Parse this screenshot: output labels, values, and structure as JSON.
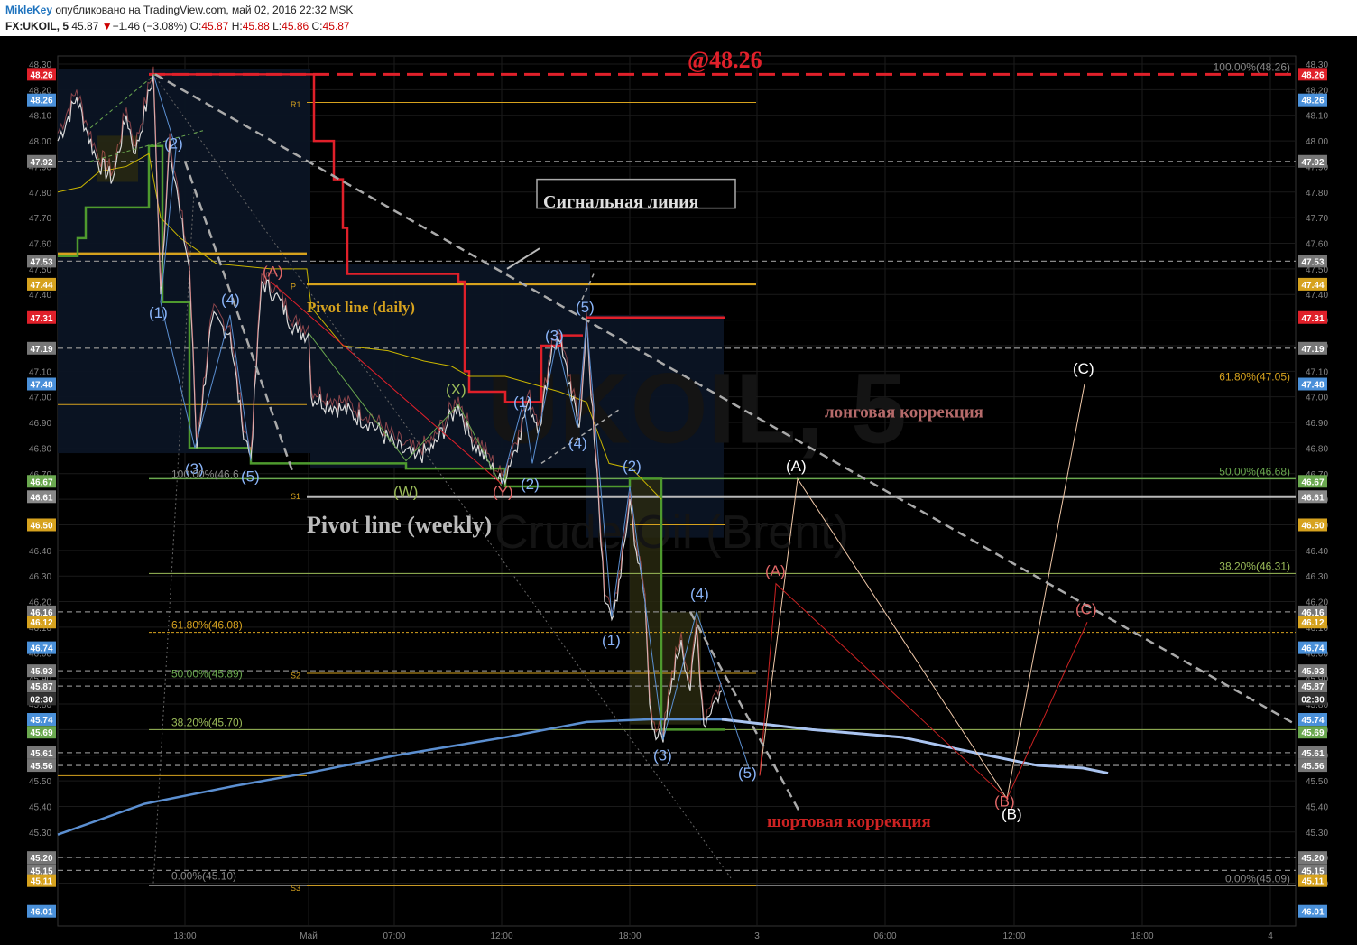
{
  "header": {
    "author": "MikleKey",
    "published": "опубликовано на TradingView.com, май 02, 2016 22:32 MSK",
    "symbol": "FX:UKOIL, 5",
    "last": "45.87",
    "down_arrow": "▼",
    "change": "−1.46 (−3.08%)",
    "o_label": "O:",
    "o_value": "45.87",
    "h_label": "H:",
    "h_value": "45.88",
    "l_label": "L:",
    "l_value": "45.86",
    "c_label": "C:",
    "c_value": "45.87"
  },
  "chart_data": {
    "type": "line",
    "ylim": [
      45.0,
      48.33
    ],
    "y_ticks": [
      "48.30",
      "48.20",
      "48.10",
      "48.00",
      "47.90",
      "47.80",
      "47.70",
      "47.60",
      "47.50",
      "47.40",
      "47.30",
      "47.20",
      "47.10",
      "47.00",
      "46.90",
      "46.80",
      "46.70",
      "46.60",
      "46.50",
      "46.40",
      "46.30",
      "46.20",
      "46.10",
      "46.00",
      "45.90",
      "45.80",
      "45.70",
      "45.60",
      "45.50",
      "45.40",
      "45.30",
      "45.20",
      "45.10"
    ],
    "x_ticks": [
      "18:00",
      "Май",
      "07:00",
      "12:00",
      "18:00",
      "3",
      "06:00",
      "12:00",
      "18:00",
      "4"
    ],
    "watermark": [
      "UKOIL, 5",
      "Crude Oil (Brent)"
    ],
    "left_price_labels": [
      {
        "text": "48.26",
        "color": "#e0202a",
        "y": 48.26
      },
      {
        "text": "48.26",
        "color": "#4a90d9",
        "y": 48.16
      },
      {
        "text": "47.92",
        "color": "#777777",
        "y": 47.92
      },
      {
        "text": "47.53",
        "color": "#777777",
        "y": 47.53
      },
      {
        "text": "47.44",
        "color": "#d6a21e",
        "y": 47.44
      },
      {
        "text": "47.31",
        "color": "#e0202a",
        "y": 47.31
      },
      {
        "text": "47.19",
        "color": "#777777",
        "y": 47.19
      },
      {
        "text": "47.48",
        "color": "#4a90d9",
        "y": 47.05
      },
      {
        "text": "46.67",
        "color": "#6aa84f",
        "y": 46.67
      },
      {
        "text": "46.61",
        "color": "#888888",
        "y": 46.61
      },
      {
        "text": "46.50",
        "color": "#d6a21e",
        "y": 46.5
      },
      {
        "text": "46.16",
        "color": "#777777",
        "y": 46.16
      },
      {
        "text": "46.12",
        "color": "#d6a21e",
        "y": 46.12
      },
      {
        "text": "46.74",
        "color": "#4a90d9",
        "y": 46.02
      },
      {
        "text": "45.93",
        "color": "#777777",
        "y": 45.93
      },
      {
        "text": "45.87",
        "color": "#777777",
        "y": 45.87
      },
      {
        "text": "02:30",
        "color": "#333333",
        "y": 45.82
      },
      {
        "text": "45.74",
        "color": "#4a90d9",
        "y": 45.74
      },
      {
        "text": "45.69",
        "color": "#6aa84f",
        "y": 45.69
      },
      {
        "text": "45.61",
        "color": "#777777",
        "y": 45.61
      },
      {
        "text": "45.56",
        "color": "#777777",
        "y": 45.56
      },
      {
        "text": "45.20",
        "color": "#777777",
        "y": 45.2
      },
      {
        "text": "45.15",
        "color": "#777777",
        "y": 45.15
      },
      {
        "text": "45.11",
        "color": "#d6a21e",
        "y": 45.11
      },
      {
        "text": "46.01",
        "color": "#4a90d9",
        "y": 44.99
      }
    ],
    "right_price_labels": [
      {
        "text": "48.26",
        "color": "#e0202a",
        "y": 48.26
      },
      {
        "text": "48.26",
        "color": "#4a90d9",
        "y": 48.16
      },
      {
        "text": "47.92",
        "color": "#777777",
        "y": 47.92
      },
      {
        "text": "47.53",
        "color": "#777777",
        "y": 47.53
      },
      {
        "text": "47.44",
        "color": "#d6a21e",
        "y": 47.44
      },
      {
        "text": "47.31",
        "color": "#e0202a",
        "y": 47.31
      },
      {
        "text": "47.19",
        "color": "#777777",
        "y": 47.19
      },
      {
        "text": "47.48",
        "color": "#4a90d9",
        "y": 47.05
      },
      {
        "text": "46.67",
        "color": "#6aa84f",
        "y": 46.67
      },
      {
        "text": "46.61",
        "color": "#888888",
        "y": 46.61
      },
      {
        "text": "46.50",
        "color": "#d6a21e",
        "y": 46.5
      },
      {
        "text": "46.16",
        "color": "#777777",
        "y": 46.16
      },
      {
        "text": "46.12",
        "color": "#d6a21e",
        "y": 46.12
      },
      {
        "text": "46.74",
        "color": "#4a90d9",
        "y": 46.02
      },
      {
        "text": "45.93",
        "color": "#777777",
        "y": 45.93
      },
      {
        "text": "45.87",
        "color": "#777777",
        "y": 45.87
      },
      {
        "text": "02:30",
        "color": "#333333",
        "y": 45.82
      },
      {
        "text": "45.74",
        "color": "#4a90d9",
        "y": 45.74
      },
      {
        "text": "45.69",
        "color": "#6aa84f",
        "y": 45.69
      },
      {
        "text": "45.61",
        "color": "#777777",
        "y": 45.61
      },
      {
        "text": "45.56",
        "color": "#777777",
        "y": 45.56
      },
      {
        "text": "45.20",
        "color": "#777777",
        "y": 45.2
      },
      {
        "text": "45.15",
        "color": "#777777",
        "y": 45.15
      },
      {
        "text": "45.11",
        "color": "#d6a21e",
        "y": 45.11
      },
      {
        "text": "46.01",
        "color": "#4a90d9",
        "y": 44.99
      }
    ],
    "fib_labels": [
      {
        "text": "100.00%(48.26)",
        "color": "#888888",
        "y": 48.26,
        "side": "right"
      },
      {
        "text": "61.80%(47.05)",
        "color": "#d6a21e",
        "y": 47.05,
        "side": "right"
      },
      {
        "text": "50.00%(46.68)",
        "color": "#6aa84f",
        "y": 46.68,
        "side": "right"
      },
      {
        "text": "38.20%(46.31)",
        "color": "#9bbb59",
        "y": 46.31,
        "side": "right"
      },
      {
        "text": "0.00%(45.09)",
        "color": "#888888",
        "y": 45.09,
        "side": "right"
      },
      {
        "text": "100.00%(46.6",
        "color": "#888888",
        "y": 46.67,
        "side": "left"
      },
      {
        "text": "61.80%(46.08)",
        "color": "#d6a21e",
        "y": 46.08,
        "side": "left"
      },
      {
        "text": "50.00%(45.89)",
        "color": "#6aa84f",
        "y": 45.89,
        "side": "left"
      },
      {
        "text": "38.20%(45.70)",
        "color": "#9bbb59",
        "y": 45.7,
        "side": "left"
      },
      {
        "text": "0.00%(45.10)",
        "color": "#888888",
        "y": 45.1,
        "side": "left"
      }
    ],
    "pivot_markers": [
      "R1",
      "P",
      "S1",
      "S2",
      "S3"
    ],
    "annotations": {
      "target": "@48.26",
      "signal_line": "Сигнальная линия",
      "pivot_daily": "Pivot line (daily)",
      "pivot_weekly": "Pivot line (weekly)",
      "long_correction": "лонговая коррекция",
      "short_correction": "шортовая коррекция"
    },
    "wave_labels": [
      {
        "text": "(2)",
        "color": "#8ab4f8"
      },
      {
        "text": "(1)",
        "color": "#8ab4f8"
      },
      {
        "text": "(4)",
        "color": "#8ab4f8"
      },
      {
        "text": "(3)",
        "color": "#8ab4f8"
      },
      {
        "text": "(5)",
        "color": "#8ab4f8"
      },
      {
        "text": "(A)",
        "color": "#e06666"
      },
      {
        "text": "(X)",
        "color": "#9bbb59"
      },
      {
        "text": "(W)",
        "color": "#9bbb59"
      },
      {
        "text": "(Y)",
        "color": "#e06666"
      },
      {
        "text": "(1)",
        "color": "#8ab4f8"
      },
      {
        "text": "(2)",
        "color": "#8ab4f8"
      },
      {
        "text": "(3)",
        "color": "#8ab4f8"
      },
      {
        "text": "(4)",
        "color": "#8ab4f8"
      },
      {
        "text": "(5)",
        "color": "#8ab4f8"
      },
      {
        "text": "(2)",
        "color": "#8ab4f8"
      },
      {
        "text": "(1)",
        "color": "#8ab4f8"
      },
      {
        "text": "(4)",
        "color": "#8ab4f8"
      },
      {
        "text": "(3)",
        "color": "#8ab4f8"
      },
      {
        "text": "(5)",
        "color": "#8ab4f8"
      },
      {
        "text": "(A)",
        "color": "#ffffff"
      },
      {
        "text": "(A)",
        "color": "#e06666"
      },
      {
        "text": "(B)",
        "color": "#e06666"
      },
      {
        "text": "(B)",
        "color": "#ffffff"
      },
      {
        "text": "(C)",
        "color": "#ffffff"
      },
      {
        "text": "(C)",
        "color": "#e06666"
      }
    ],
    "series": [
      {
        "name": "",
        "color": "#cccccc"
      }
    ]
  }
}
